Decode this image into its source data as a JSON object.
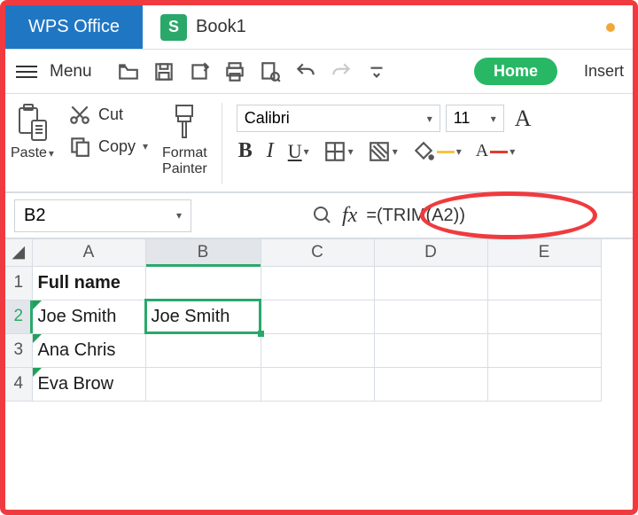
{
  "app": {
    "name": "WPS Office"
  },
  "tab": {
    "icon_letter": "S",
    "title": "Book1"
  },
  "menu": {
    "label": "Menu"
  },
  "ribbon_tabs": {
    "home": "Home",
    "insert": "Insert"
  },
  "toolbar": {
    "paste": "Paste",
    "cut": "Cut",
    "copy": "Copy",
    "format_painter_line1": "Format",
    "format_painter_line2": "Painter"
  },
  "font": {
    "name": "Calibri",
    "size": "11"
  },
  "name_box": {
    "value": "B2"
  },
  "formula": {
    "text": "=(TRIM(A2))"
  },
  "columns": [
    "A",
    "B",
    "C",
    "D",
    "E"
  ],
  "rows": [
    {
      "num": "1",
      "A": "Full name",
      "B": ""
    },
    {
      "num": "2",
      "A": " Joe Smith",
      "B": "Joe Smith"
    },
    {
      "num": "3",
      "A": " Ana Chris",
      "B": ""
    },
    {
      "num": "4",
      "A": " Eva Brow",
      "B": ""
    }
  ]
}
